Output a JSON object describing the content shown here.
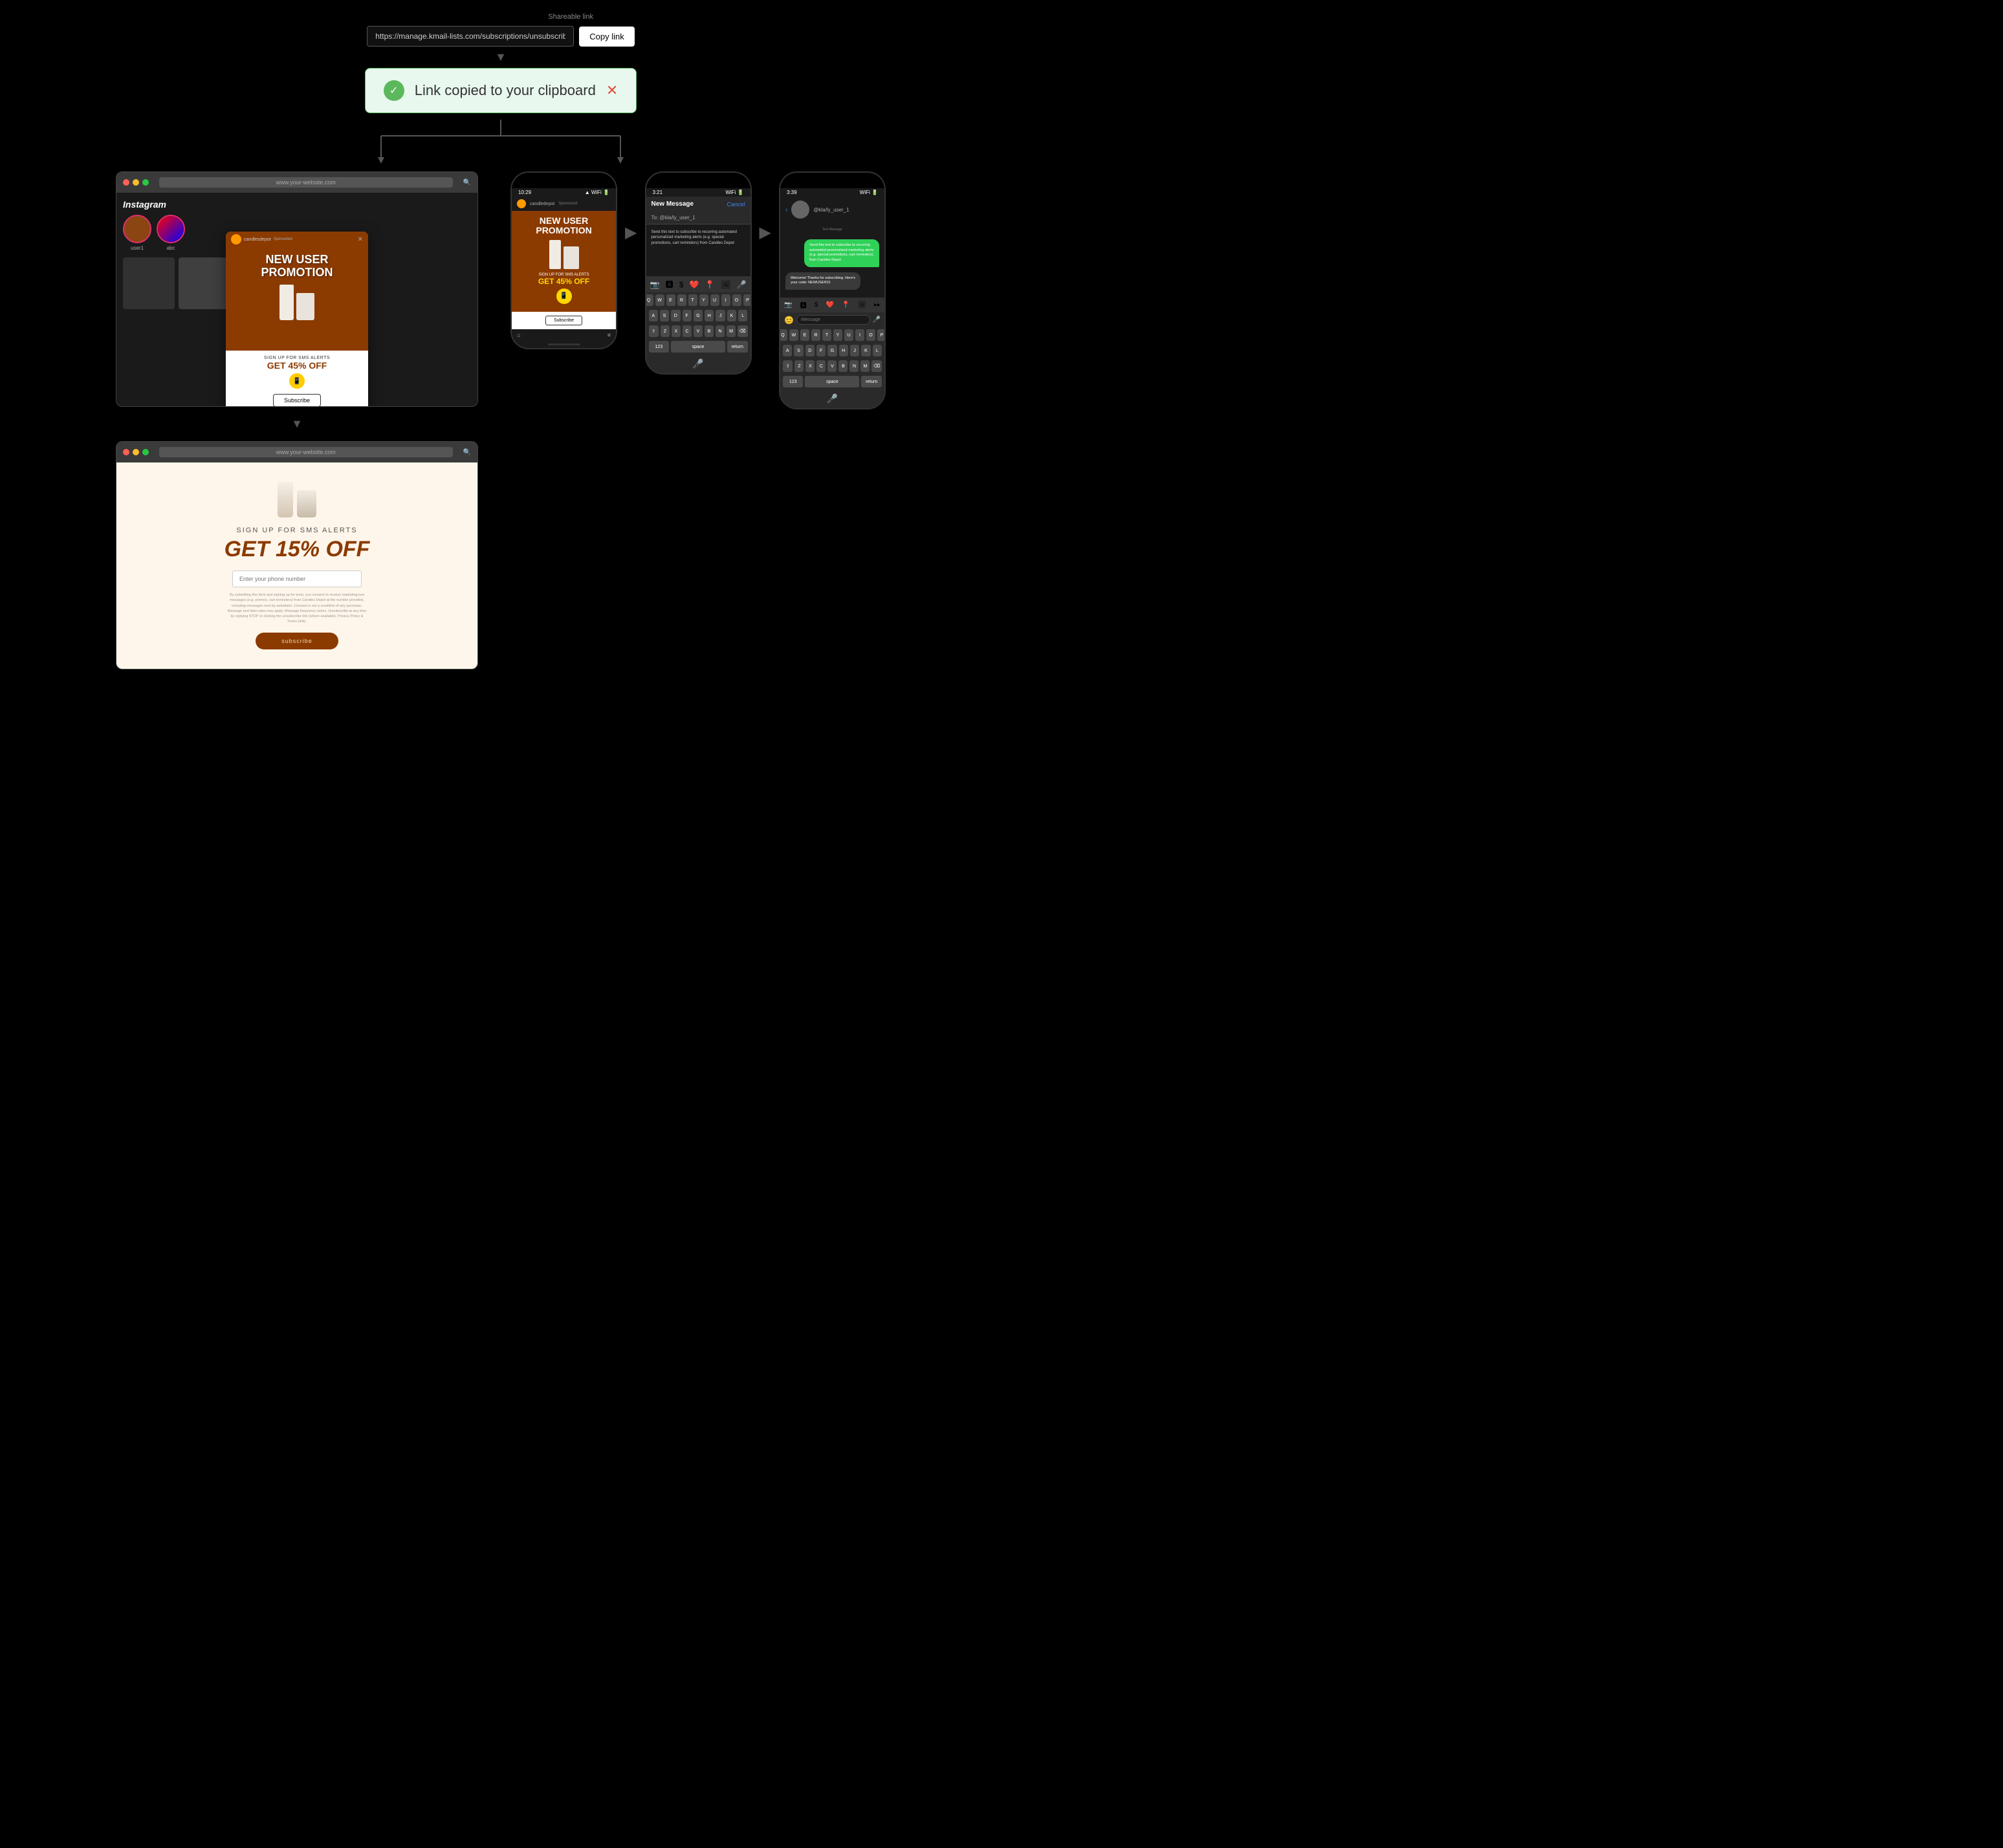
{
  "shareable": {
    "label": "Shareable link",
    "url": "https://manage.kmail-lists.com/subscriptions/unsubscribed?...",
    "copy_btn": "Copy link"
  },
  "notification": {
    "text": "Link copied to your clipboard",
    "close": "✕"
  },
  "desktop_mockup_1": {
    "url": "www.your-website.com",
    "ig_label": "Instagram",
    "sponsored": "Sponsored",
    "brand": "candlesdepot",
    "promo_line1": "NEW USER",
    "promo_line2": "PROMOTION",
    "sms_text": "SIGN UP FOR SMS ALERTS",
    "discount": "GET 45% OFF",
    "subscribe": "Subscribe"
  },
  "phone1": {
    "time": "10:29",
    "brand": "candledepot",
    "sponsored": "Sponsored",
    "promo_line1": "NEW USER",
    "promo_line2": "PROMOTION",
    "sms_text": "SIGN UP FOR SMS ALERTS",
    "discount": "GET 45% OFF",
    "subscribe": "Subscribe"
  },
  "phone2": {
    "time": "3:21",
    "title": "New Message",
    "cancel": "Cancel",
    "to_label": "To: @kla/ly_user_1",
    "message": "Send this text to subscribe to recurring automated personalized marketing alerts (e.g. special promotions, cart reminders) from Candles Depot",
    "keyboard_rows": [
      [
        "Q",
        "W",
        "E",
        "R",
        "T",
        "Y",
        "U",
        "I",
        "O",
        "P"
      ],
      [
        "A",
        "S",
        "D",
        "F",
        "G",
        "H",
        "J",
        "K",
        "L"
      ],
      [
        "⇧",
        "Z",
        "X",
        "C",
        "V",
        "B",
        "N",
        "M",
        "⌫"
      ],
      [
        "123",
        "space",
        "return"
      ]
    ]
  },
  "phone3": {
    "time": "3:39",
    "contact": "@kla/ly_user_1",
    "bubble1": "Send this text to subscribe to recurring automated personalized marketing alerts (e.g. special promotions, cart reminders) from Candles Depot",
    "bubble2": "Welcome! Thanks for subscribing. Here's your code: NEWUSER15",
    "text_placeholder": "iMessage"
  },
  "desktop_mockup_2": {
    "url": "www.your-website.com",
    "sms_title": "SIGN UP FOR SMS ALERTS",
    "discount": "GET 15% OFF",
    "phone_placeholder": "Enter your phone number",
    "legal": "By submitting this form and signing up for texts, you consent to receive marketing text messages (e.g. promos, cart reminders) from Candles Depot at the number provided, including messages sent by autodialer. Consent is not a condition of any purchase. Message and data rates may apply. Message frequency varies. Unsubscribe at any time by replying STOP or clicking the unsubscribe link (where available). Privacy Policy & Terms (link).",
    "subscribe_btn": "subscribe"
  }
}
